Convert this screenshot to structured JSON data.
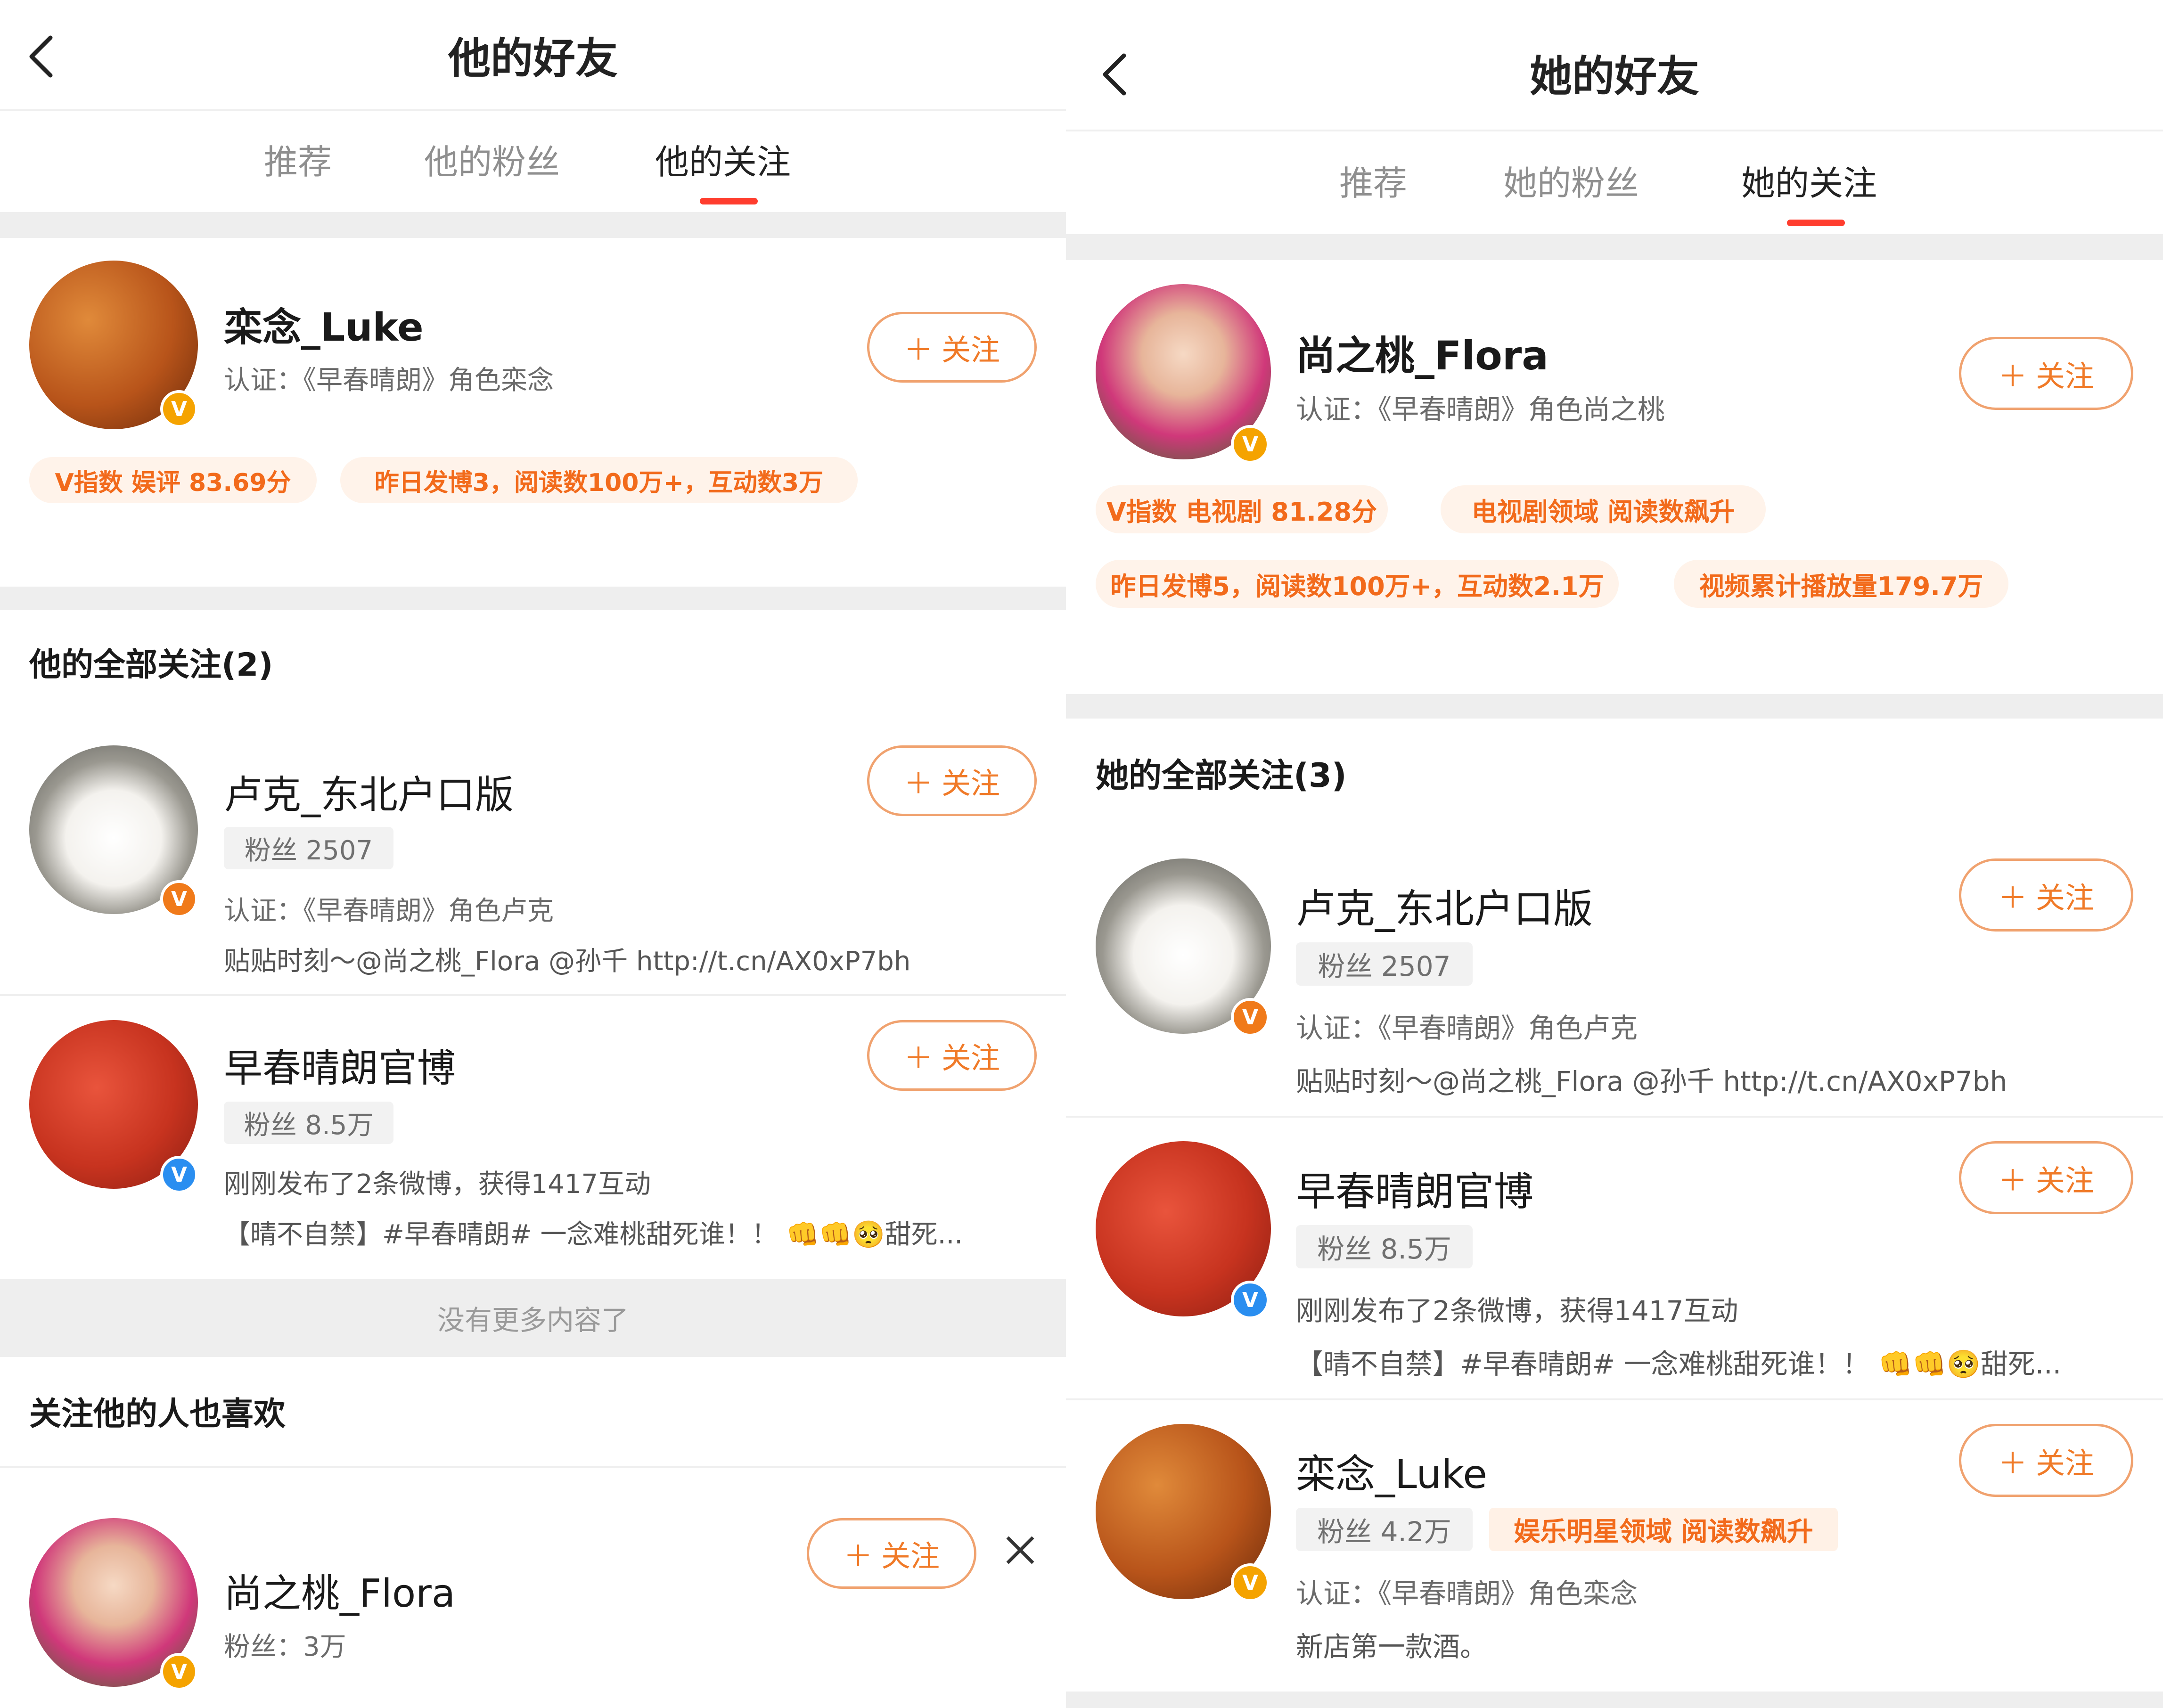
{
  "left": {
    "header_title": "他的好友",
    "tabs": [
      "推荐",
      "他的粉丝",
      "他的关注"
    ],
    "active_tab": 2,
    "featured": {
      "name": "栾念_Luke",
      "cert": "认证：《早春晴朗》角色栾念",
      "tag1": "V指数 娱评 83.69分",
      "tag2": "昨日发博3，阅读数100万+，互动数3万",
      "follow": "关注"
    },
    "section_title": "他的全部关注(2)",
    "users": [
      {
        "name": "卢克_东北户口版",
        "fans": "粉丝 2507",
        "line1": "认证：《早春晴朗》角色卢克",
        "line2": "贴贴时刻～@尚之桃_Flora @孙千 http://t.cn/AX0xP7bh",
        "follow": "关注"
      },
      {
        "name": "早春晴朗官博",
        "fans": "粉丝 8.5万",
        "line1": "刚刚发布了2条微博，获得1417互动",
        "line2": "【晴不自禁】#早春晴朗# 一念难桃甜死谁！！",
        "line2_end": "甜死...",
        "follow": "关注"
      }
    ],
    "no_more": "没有更多内容了",
    "rec_title": "关注他的人也喜欢",
    "rec_user": {
      "name": "尚之桃_Flora",
      "fans": "粉丝：3万",
      "follow": "关注"
    }
  },
  "right": {
    "header_title": "她的好友",
    "tabs": [
      "推荐",
      "她的粉丝",
      "她的关注"
    ],
    "active_tab": 2,
    "featured": {
      "name": "尚之桃_Flora",
      "cert": "认证：《早春晴朗》角色尚之桃",
      "tag1": "V指数 电视剧 81.28分",
      "tag2": "电视剧领域 阅读数飙升",
      "tag3": "昨日发博5，阅读数100万+，互动数2.1万",
      "tag4": "视频累计播放量179.7万",
      "follow": "关注"
    },
    "section_title": "她的全部关注(3)",
    "users": [
      {
        "name": "卢克_东北户口版",
        "fans": "粉丝 2507",
        "line1": "认证：《早春晴朗》角色卢克",
        "line2": "贴贴时刻～@尚之桃_Flora @孙千 http://t.cn/AX0xP7bh",
        "follow": "关注"
      },
      {
        "name": "早春晴朗官博",
        "fans": "粉丝 8.5万",
        "line1": "刚刚发布了2条微博，获得1417互动",
        "line2": "【晴不自禁】#早春晴朗# 一念难桃甜死谁！！",
        "line2_end": "甜死...",
        "follow": "关注"
      },
      {
        "name": "栾念_Luke",
        "fans": "粉丝 4.2万",
        "tag": "娱乐明星领域 阅读数飙升",
        "line1": "认证：《早春晴朗》角色栾念",
        "line2": "新店第一款酒。",
        "follow": "关注"
      }
    ]
  },
  "icons": {
    "back": "chevron-left-icon",
    "plus": "＋",
    "close": "close-icon",
    "verified": "V",
    "emoji_fist": "👊",
    "emoji_pleading": "🥺"
  },
  "colors": {
    "accent_red": "#ff3d2e",
    "orange": "#f07a28",
    "gray_bg": "#eeeeee"
  }
}
